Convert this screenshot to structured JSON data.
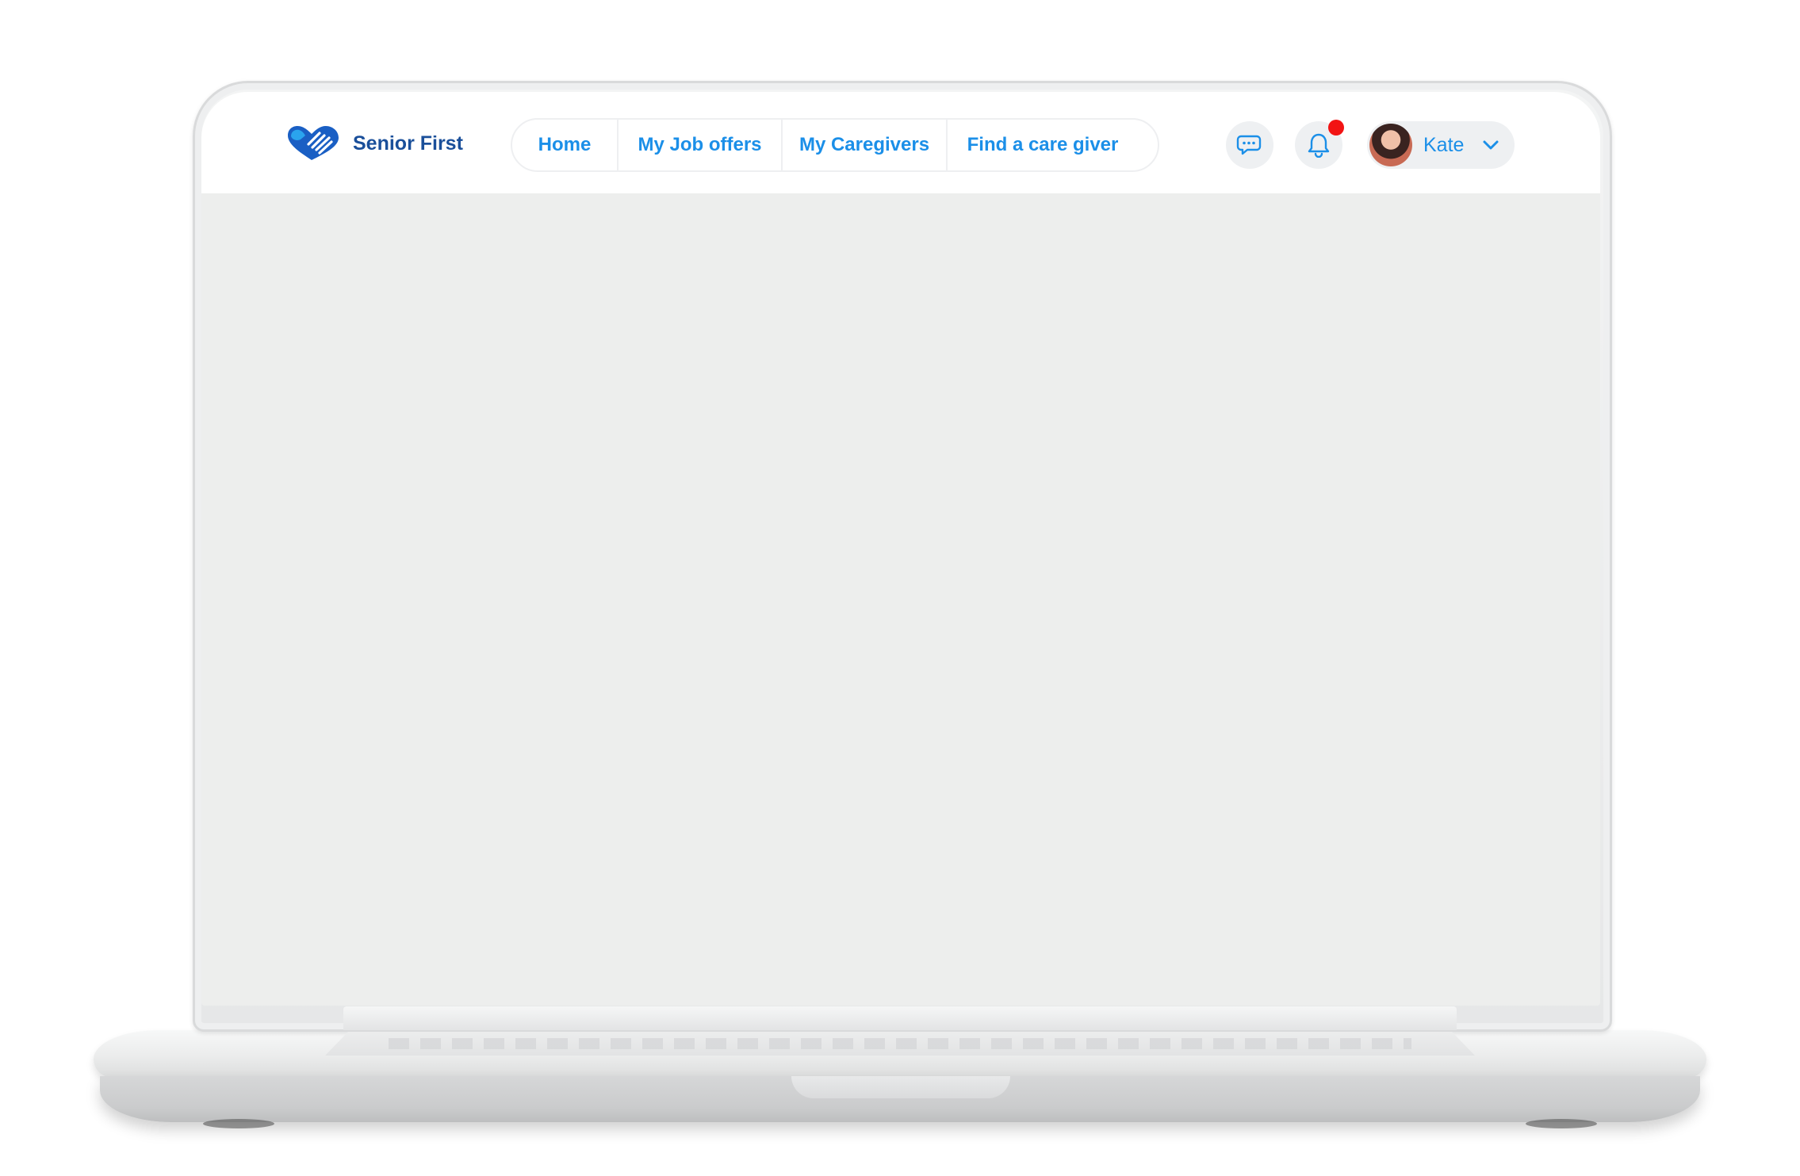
{
  "brand": {
    "name": "Senior First",
    "logo_icon": "heart-hands-logo-icon",
    "color": "#1a4f9a"
  },
  "nav": {
    "items": [
      {
        "label": "Home"
      },
      {
        "label": "My Job offers"
      },
      {
        "label": "My Caregivers"
      },
      {
        "label": "Find a care giver"
      }
    ],
    "accent": "#1b8fe8"
  },
  "actions": {
    "messages_icon": "chat-bubbles-icon",
    "notifications_icon": "bell-icon",
    "notification_badge_color": "#f21414"
  },
  "user": {
    "name": "Kate",
    "menu_icon": "chevron-down-icon"
  },
  "screen": {
    "background": "#edeeed"
  }
}
